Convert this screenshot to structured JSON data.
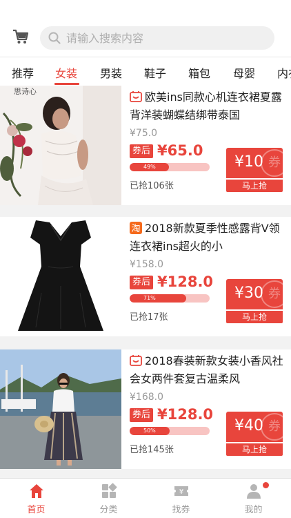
{
  "search": {
    "placeholder": "请输入搜索内容"
  },
  "tabs": [
    {
      "label": "推荐"
    },
    {
      "label": "女装",
      "active": true
    },
    {
      "label": "男装"
    },
    {
      "label": "鞋子"
    },
    {
      "label": "箱包"
    },
    {
      "label": "母婴"
    },
    {
      "label": "内衣"
    }
  ],
  "products": [
    {
      "platform": "tmall",
      "title": "欧美ins同款心机连衣裙夏露背洋装蝴蝶结绑带泰国",
      "original_price": "¥75.0",
      "coupon_tag": "券后",
      "price": "¥65.0",
      "progress_percent": 49,
      "progress_label": "49%",
      "grabbed": "已抢106张",
      "coupon_value": "¥10",
      "coupon_watermark": "券",
      "grab_button": "马上抢",
      "image_text": "思诗心"
    },
    {
      "platform": "taobao",
      "title": "2018新款夏季性感露背V领连衣裙ins超火的小",
      "original_price": "¥158.0",
      "coupon_tag": "券后",
      "price": "¥128.0",
      "progress_percent": 71,
      "progress_label": "71%",
      "grabbed": "已抢17张",
      "coupon_value": "¥30",
      "coupon_watermark": "券",
      "grab_button": "马上抢"
    },
    {
      "platform": "tmall",
      "title": "2018春装新款女装小香风社会女两件套复古温柔风",
      "original_price": "¥168.0",
      "coupon_tag": "券后",
      "price": "¥128.0",
      "progress_percent": 50,
      "progress_label": "50%",
      "grabbed": "已抢145张",
      "coupon_value": "¥40",
      "coupon_watermark": "券",
      "grab_button": "马上抢"
    }
  ],
  "bottom_nav": [
    {
      "label": "首页",
      "icon": "home-icon",
      "active": true
    },
    {
      "label": "分类",
      "icon": "category-icon"
    },
    {
      "label": "找券",
      "icon": "coupon-icon"
    },
    {
      "label": "我的",
      "icon": "profile-icon",
      "badge": true
    }
  ],
  "colors": {
    "accent": "#e8453c",
    "tab_active": "#e8453c",
    "muted": "#999999"
  }
}
